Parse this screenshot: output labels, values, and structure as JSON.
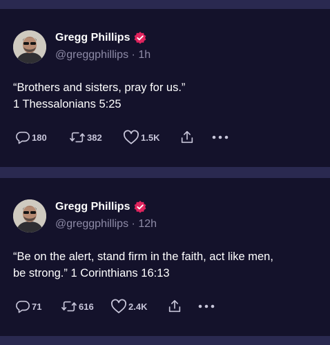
{
  "posts": [
    {
      "author_name": "Gregg Phillips",
      "handle": "@greggphillips",
      "separator": "·",
      "time": "1h",
      "text_line1": "“Brothers and sisters, pray for us.”",
      "text_line2": "1 Thessalonians 5:25",
      "replies": "180",
      "reposts": "382",
      "likes": "1.5K"
    },
    {
      "author_name": "Gregg Phillips",
      "handle": "@greggphillips",
      "separator": "·",
      "time": "12h",
      "text_line1": "“Be on the alert, stand firm in the faith, act like men,",
      "text_line2": "be strong.” 1 Corinthians 16:13",
      "replies": "71",
      "reposts": "616",
      "likes": "2.4K"
    }
  ],
  "colors": {
    "background": "#2a2950",
    "card": "#14122b",
    "verified_badge": "#e0245e",
    "muted_text": "#8e8ba7",
    "icon": "#c7c5d9"
  },
  "icons": [
    "reply-icon",
    "repost-icon",
    "like-icon",
    "share-icon",
    "more-icon",
    "verified-icon"
  ]
}
